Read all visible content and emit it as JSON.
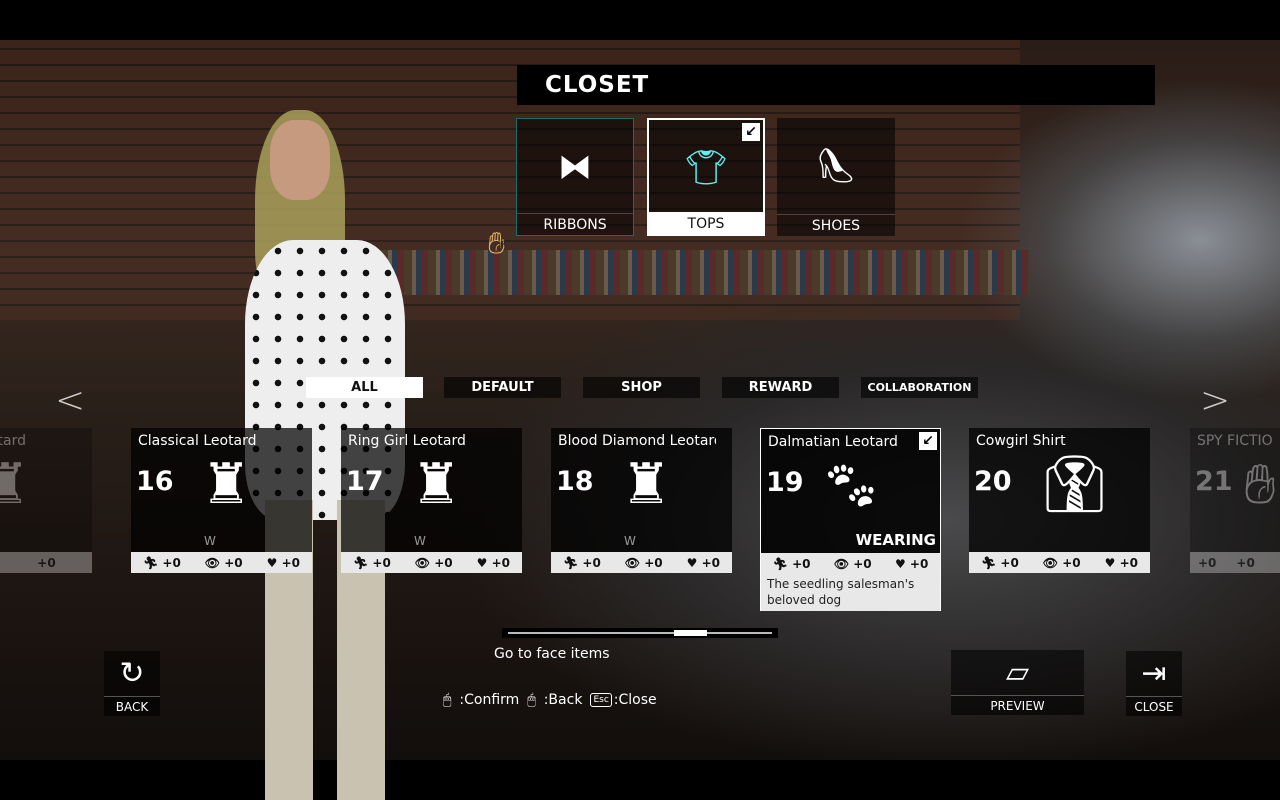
{
  "title": "CLOSET",
  "categories": [
    {
      "label": "RIBBONS",
      "icon": "bow-icon"
    },
    {
      "label": "TOPS",
      "icon": "shirt-icon",
      "active": true,
      "accent": "#5ff0f0"
    },
    {
      "label": "SHOES",
      "icon": "high-heel-icon"
    }
  ],
  "hand_badge": "R",
  "filters": [
    {
      "label": "ALL",
      "active": true
    },
    {
      "label": "DEFAULT"
    },
    {
      "label": "SHOP"
    },
    {
      "label": "REWARD"
    },
    {
      "label": "COLLABORATION"
    }
  ],
  "items": [
    {
      "name": "otard",
      "stat": "+0"
    },
    {
      "name": "Classical Leotard",
      "number": "16",
      "tag": "W",
      "stats": [
        "+0",
        "+0",
        "+0"
      ]
    },
    {
      "name": "Ring Girl Leotard",
      "number": "17",
      "tag": "W",
      "stats": [
        "+0",
        "+0",
        "+0"
      ]
    },
    {
      "name": "Blood Diamond Leotard",
      "number": "18",
      "tag": "W",
      "stats": [
        "+0",
        "+0",
        "+0"
      ]
    },
    {
      "name": "Dalmatian Leotard",
      "number": "19",
      "status": "WEARING",
      "stats": [
        "+0",
        "+0",
        "+0"
      ],
      "description": "The seedling salesman's beloved dog"
    },
    {
      "name": "Cowgirl Shirt",
      "number": "20",
      "stats": [
        "+0",
        "+0",
        "+0"
      ]
    },
    {
      "name": "SPY FICTIO",
      "number": "21",
      "stats": [
        "+0",
        "+0"
      ]
    }
  ],
  "scroll_progress": 0.72,
  "goto_label": "Go to face items",
  "hints": {
    "confirm": ":Confirm",
    "back": ":Back",
    "esc_key": "Esc",
    "close": ":Close"
  },
  "buttons": {
    "back": "BACK",
    "preview": "PREVIEW",
    "close": "CLOSE"
  }
}
